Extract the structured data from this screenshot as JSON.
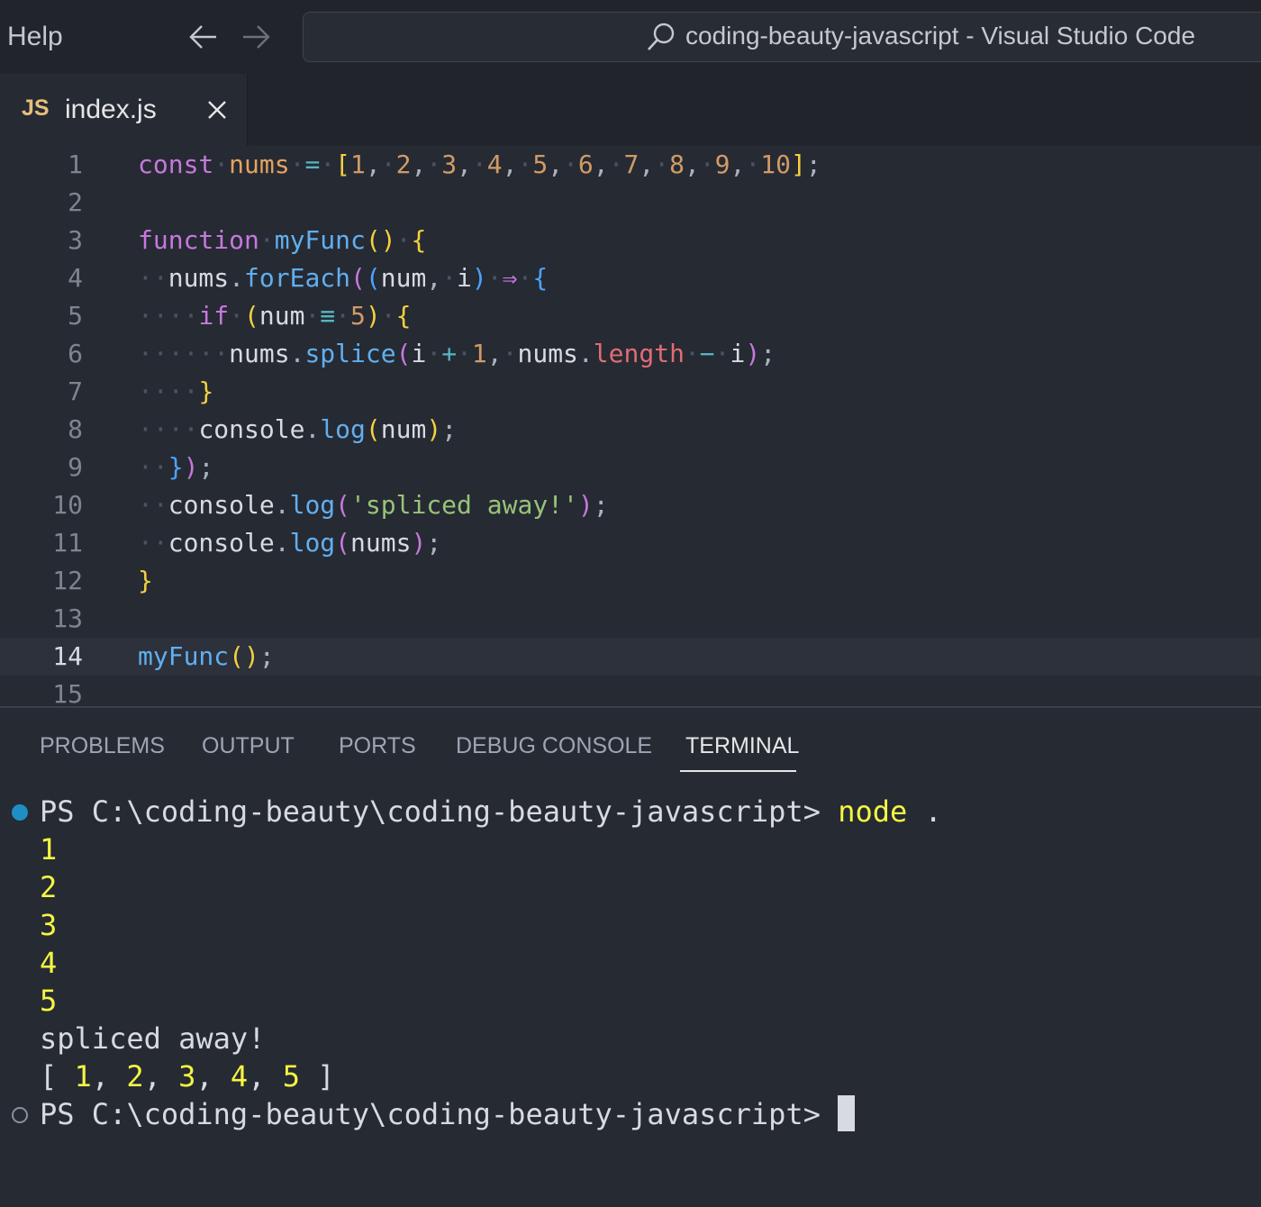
{
  "menu": {
    "help": "Help"
  },
  "command_center": {
    "title": "coding-beauty-javascript - Visual Studio Code"
  },
  "tab": {
    "icon": "JS",
    "label": "index.js"
  },
  "editor": {
    "lines": [
      {
        "n": "1",
        "current": false,
        "tokens": [
          [
            "const",
            "kw"
          ],
          [
            " ",
            "ws"
          ],
          [
            "nums",
            "var"
          ],
          [
            " ",
            "ws"
          ],
          [
            "=",
            "op"
          ],
          [
            " ",
            "ws"
          ],
          [
            "[",
            "b1"
          ],
          [
            "1",
            "num"
          ],
          [
            ",",
            "p"
          ],
          [
            " ",
            "ws"
          ],
          [
            "2",
            "num"
          ],
          [
            ",",
            "p"
          ],
          [
            " ",
            "ws"
          ],
          [
            "3",
            "num"
          ],
          [
            ",",
            "p"
          ],
          [
            " ",
            "ws"
          ],
          [
            "4",
            "num"
          ],
          [
            ",",
            "p"
          ],
          [
            " ",
            "ws"
          ],
          [
            "5",
            "num"
          ],
          [
            ",",
            "p"
          ],
          [
            " ",
            "ws"
          ],
          [
            "6",
            "num"
          ],
          [
            ",",
            "p"
          ],
          [
            " ",
            "ws"
          ],
          [
            "7",
            "num"
          ],
          [
            ",",
            "p"
          ],
          [
            " ",
            "ws"
          ],
          [
            "8",
            "num"
          ],
          [
            ",",
            "p"
          ],
          [
            " ",
            "ws"
          ],
          [
            "9",
            "num"
          ],
          [
            ",",
            "p"
          ],
          [
            " ",
            "ws"
          ],
          [
            "10",
            "num"
          ],
          [
            "]",
            "b1"
          ],
          [
            ";",
            "p"
          ]
        ]
      },
      {
        "n": "2",
        "current": false,
        "tokens": []
      },
      {
        "n": "3",
        "current": false,
        "tokens": [
          [
            "function",
            "kw"
          ],
          [
            " ",
            "ws"
          ],
          [
            "myFunc",
            "fn"
          ],
          [
            "()",
            "b1"
          ],
          [
            " ",
            "ws"
          ],
          [
            "{",
            "b1"
          ]
        ]
      },
      {
        "n": "4",
        "current": false,
        "tokens": [
          [
            "  ",
            "ws"
          ],
          [
            "nums",
            "id"
          ],
          [
            ".",
            "p"
          ],
          [
            "forEach",
            "fn"
          ],
          [
            "(",
            "b2"
          ],
          [
            "(",
            "b3"
          ],
          [
            "num",
            "id"
          ],
          [
            ",",
            "p"
          ],
          [
            " ",
            "ws"
          ],
          [
            "i",
            "id"
          ],
          [
            ")",
            "b3"
          ],
          [
            " ",
            "ws"
          ],
          [
            "⇒",
            "kw"
          ],
          [
            " ",
            "ws"
          ],
          [
            "{",
            "b3"
          ]
        ]
      },
      {
        "n": "5",
        "current": false,
        "tokens": [
          [
            "    ",
            "ws"
          ],
          [
            "if",
            "kw"
          ],
          [
            " ",
            "ws"
          ],
          [
            "(",
            "b1"
          ],
          [
            "num",
            "id"
          ],
          [
            " ",
            "ws"
          ],
          [
            "≡",
            "op"
          ],
          [
            " ",
            "ws"
          ],
          [
            "5",
            "num"
          ],
          [
            ")",
            "b1"
          ],
          [
            " ",
            "ws"
          ],
          [
            "{",
            "b1"
          ]
        ]
      },
      {
        "n": "6",
        "current": false,
        "tokens": [
          [
            "      ",
            "ws"
          ],
          [
            "nums",
            "id"
          ],
          [
            ".",
            "p"
          ],
          [
            "splice",
            "fn"
          ],
          [
            "(",
            "b2"
          ],
          [
            "i",
            "id"
          ],
          [
            " ",
            "ws"
          ],
          [
            "+",
            "op"
          ],
          [
            " ",
            "ws"
          ],
          [
            "1",
            "num"
          ],
          [
            ",",
            "p"
          ],
          [
            " ",
            "ws"
          ],
          [
            "nums",
            "id"
          ],
          [
            ".",
            "p"
          ],
          [
            "length",
            "prop"
          ],
          [
            " ",
            "ws"
          ],
          [
            "−",
            "op"
          ],
          [
            " ",
            "ws"
          ],
          [
            "i",
            "id"
          ],
          [
            ")",
            "b2"
          ],
          [
            ";",
            "p"
          ]
        ]
      },
      {
        "n": "7",
        "current": false,
        "tokens": [
          [
            "    ",
            "ws"
          ],
          [
            "}",
            "b1"
          ]
        ]
      },
      {
        "n": "8",
        "current": false,
        "tokens": [
          [
            "    ",
            "ws"
          ],
          [
            "console",
            "id"
          ],
          [
            ".",
            "p"
          ],
          [
            "log",
            "fn"
          ],
          [
            "(",
            "b1"
          ],
          [
            "num",
            "id"
          ],
          [
            ")",
            "b1"
          ],
          [
            ";",
            "p"
          ]
        ]
      },
      {
        "n": "9",
        "current": false,
        "tokens": [
          [
            "  ",
            "ws"
          ],
          [
            "}",
            "b3"
          ],
          [
            ")",
            "b2"
          ],
          [
            ";",
            "p"
          ]
        ]
      },
      {
        "n": "10",
        "current": false,
        "tokens": [
          [
            "  ",
            "ws"
          ],
          [
            "console",
            "id"
          ],
          [
            ".",
            "p"
          ],
          [
            "log",
            "fn"
          ],
          [
            "(",
            "b2"
          ],
          [
            "'spliced away!'",
            "str"
          ],
          [
            ")",
            "b2"
          ],
          [
            ";",
            "p"
          ]
        ]
      },
      {
        "n": "11",
        "current": false,
        "tokens": [
          [
            "  ",
            "ws"
          ],
          [
            "console",
            "id"
          ],
          [
            ".",
            "p"
          ],
          [
            "log",
            "fn"
          ],
          [
            "(",
            "b2"
          ],
          [
            "nums",
            "id"
          ],
          [
            ")",
            "b2"
          ],
          [
            ";",
            "p"
          ]
        ]
      },
      {
        "n": "12",
        "current": false,
        "tokens": [
          [
            "}",
            "b1"
          ]
        ]
      },
      {
        "n": "13",
        "current": false,
        "tokens": []
      },
      {
        "n": "14",
        "current": true,
        "tokens": [
          [
            "myFunc",
            "fn"
          ],
          [
            "()",
            "b1"
          ],
          [
            ";",
            "p"
          ]
        ]
      },
      {
        "n": "15",
        "current": false,
        "tokens": []
      }
    ]
  },
  "panel": {
    "tabs": [
      "PROBLEMS",
      "OUTPUT",
      "PORTS",
      "DEBUG CONSOLE",
      "TERMINAL"
    ],
    "active": "TERMINAL"
  },
  "terminal": {
    "prompt": "PS C:\\coding-beauty\\coding-beauty-javascript>",
    "command": "node",
    "arg": ".",
    "output_numbers": [
      "1",
      "2",
      "3",
      "4",
      "5"
    ],
    "spliced_text": "spliced away!",
    "array_open": "[",
    "array_values": [
      "1",
      "2",
      "3",
      "4",
      "5"
    ],
    "array_close": "]"
  },
  "colors": {
    "kw": "#c678dd",
    "var": "#e5a25f",
    "op": "#56b6c2",
    "num": "#d19a66",
    "p": "#abb2bf",
    "b1": "#f4d03f",
    "b2": "#c678dd",
    "b3": "#4da3ff",
    "fn": "#61afef",
    "id": "#d7dae0",
    "str": "#98c379",
    "prop": "#e06c75",
    "ws": "#4b5263",
    "terminal_yellow": "#f5f543"
  },
  "icons": {
    "back": "arrow-left-icon",
    "forward": "arrow-right-icon",
    "search": "search-icon",
    "close": "close-icon"
  }
}
